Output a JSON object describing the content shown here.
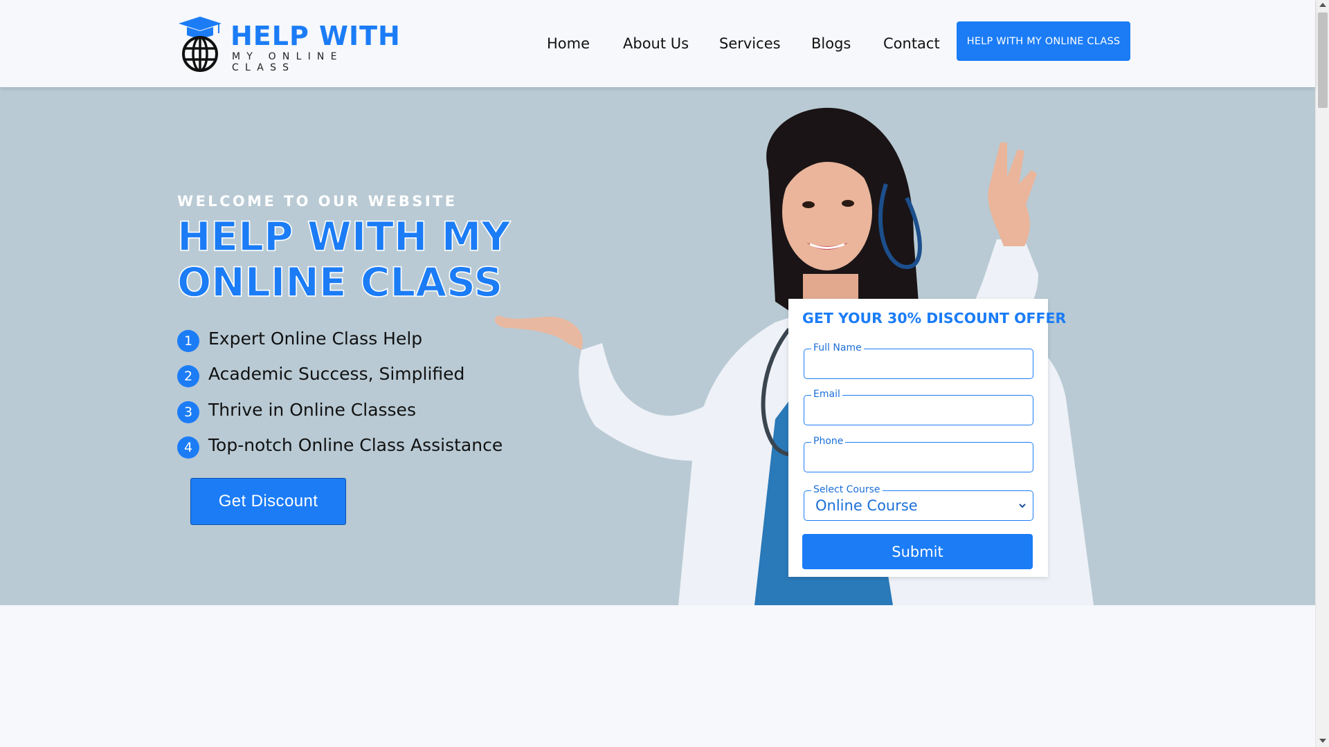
{
  "header": {
    "logo": {
      "title": "HELP WITH",
      "subtitle": "MY ONLINE CLASS"
    },
    "nav": [
      {
        "label": "Home"
      },
      {
        "label": "About Us"
      },
      {
        "label": "Services"
      },
      {
        "label": "Blogs"
      },
      {
        "label": "Contact"
      }
    ],
    "cta_label": "HELP WITH MY ONLINE CLASS"
  },
  "hero": {
    "welcome": "WELCOME TO OUR WEBSITE",
    "title": "HELP WITH MY ONLINE CLASS",
    "features": [
      {
        "num": "1",
        "text": "Expert Online Class Help"
      },
      {
        "num": "2",
        "text": "Academic Success, Simplified"
      },
      {
        "num": "3",
        "text": "Thrive in Online Classes"
      },
      {
        "num": "4",
        "text": "Top-notch Online Class Assistance"
      }
    ],
    "button_label": "Get Discount"
  },
  "form": {
    "title": "GET YOUR 30% DISCOUNT OFFER",
    "full_name_label": "Full Name",
    "email_label": "Email",
    "phone_label": "Phone",
    "course_label": "Select Course",
    "course_selected": "Online Course",
    "submit_label": "Submit"
  },
  "colors": {
    "accent": "#1b7cf6",
    "hero_bg": "#b9cad4",
    "page_bg": "#f6f8fb"
  },
  "icons": [
    "graduation-globe-logo-icon",
    "chevron-down-icon"
  ]
}
